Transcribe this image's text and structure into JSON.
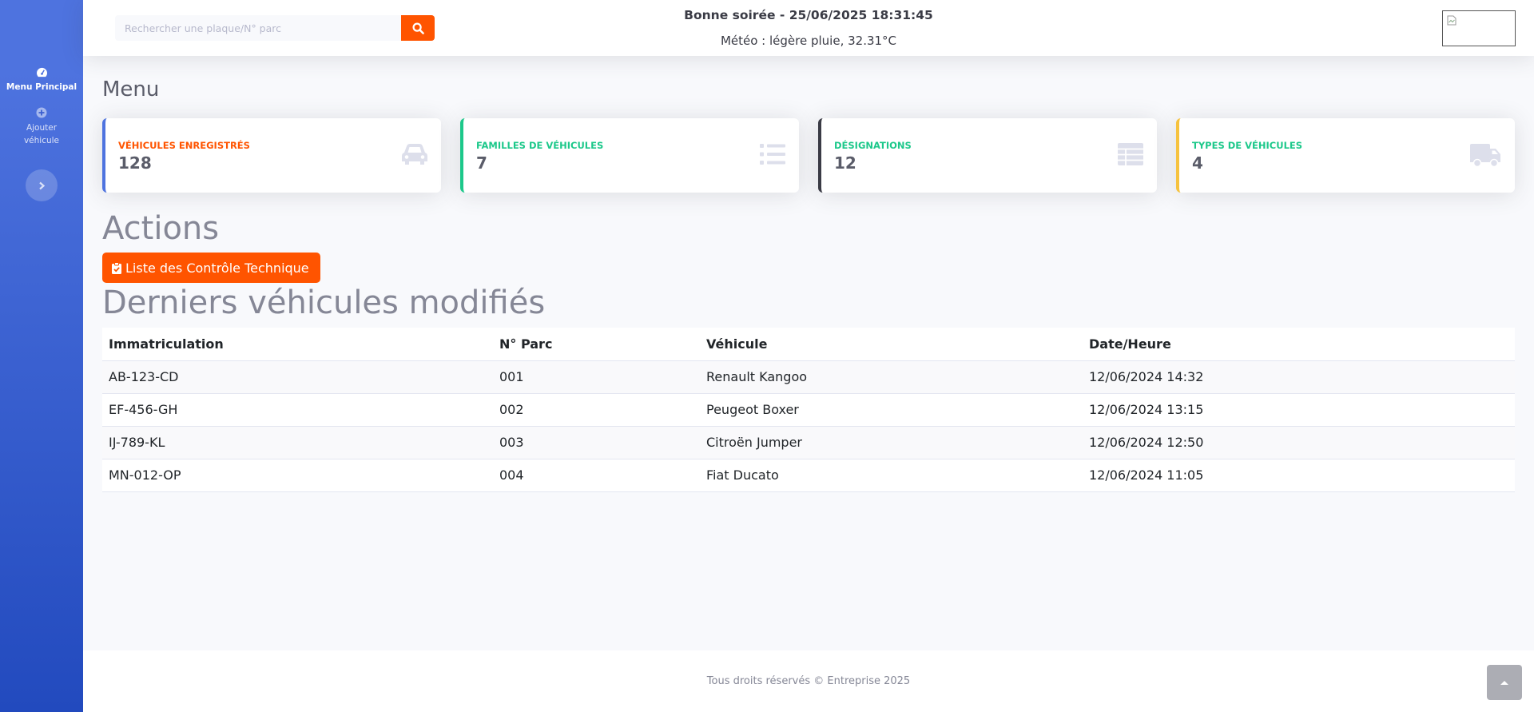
{
  "sidebar": {
    "items": [
      {
        "label": "Menu Principal",
        "icon": "dashboard-icon"
      },
      {
        "label": "Ajouter véhicule",
        "icon": "plus-circle-icon"
      }
    ],
    "toggle_icon": "chevron-right-icon"
  },
  "topbar": {
    "search": {
      "placeholder": "Rechercher une plaque/N° parc",
      "value": "",
      "button_icon": "search-icon"
    },
    "greeting": "Bonne soirée - 25/06/2025 18:31:45",
    "weather": "Météo : légère pluie, 32.31°C",
    "logo": "broken-image-icon"
  },
  "main": {
    "title": "Menu",
    "cards": [
      {
        "label": "Véhicules enregistrés",
        "value": "128",
        "color": "#4e73df",
        "label_color": "#ff5400",
        "icon": "car-icon"
      },
      {
        "label": "Familles de véhicules",
        "value": "7",
        "color": "#1cc88a",
        "label_color": "#1cc88a",
        "icon": "list-icon"
      },
      {
        "label": "Désignations",
        "value": "12",
        "color": "#3a3b45",
        "label_color": "#1cc88a",
        "icon": "table-icon"
      },
      {
        "label": "Types de véhicules",
        "value": "4",
        "color": "#f6c23e",
        "label_color": "#1cc88a",
        "icon": "truck-icon"
      }
    ],
    "actions_title": "Actions",
    "actions_button": "Liste des Contrôle Technique",
    "recent_title": "Derniers véhicules modifiés",
    "table": {
      "headers": [
        "Immatriculation",
        "N° Parc",
        "Véhicule",
        "Date/Heure"
      ],
      "rows": [
        [
          "AB-123-CD",
          "001",
          "Renault Kangoo",
          "12/06/2024 14:32"
        ],
        [
          "EF-456-GH",
          "002",
          "Peugeot Boxer",
          "12/06/2024 13:15"
        ],
        [
          "IJ-789-KL",
          "003",
          "Citroën Jumper",
          "12/06/2024 12:50"
        ],
        [
          "MN-012-OP",
          "004",
          "Fiat Ducato",
          "12/06/2024 11:05"
        ]
      ]
    }
  },
  "footer": {
    "text": "Tous droits réservés © Entreprise 2025"
  },
  "colors": {
    "accent": "#ff5400",
    "primary": "#4e73df"
  }
}
